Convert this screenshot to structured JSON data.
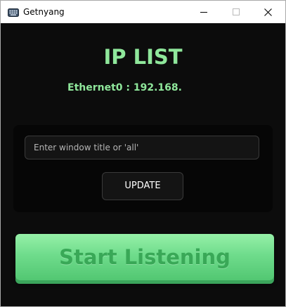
{
  "window": {
    "title": "Getnyang",
    "icon": "keyboard-icon",
    "controls": [
      "minimize-icon",
      "maximize-icon",
      "close-icon"
    ]
  },
  "main": {
    "heading": "IP LIST",
    "ip_entries": [
      {
        "name": "Ethernet0",
        "separator": " : ",
        "address": "192.168."
      }
    ],
    "search": {
      "value": "",
      "placeholder": "Enter window title or 'all'"
    },
    "update_label": "UPDATE",
    "start_label": "Start Listening"
  },
  "colors": {
    "background": "#0c0c0c",
    "accent_green": "#8fe79b",
    "button_green": "#6fdc8c",
    "button_text": "#39a857"
  }
}
